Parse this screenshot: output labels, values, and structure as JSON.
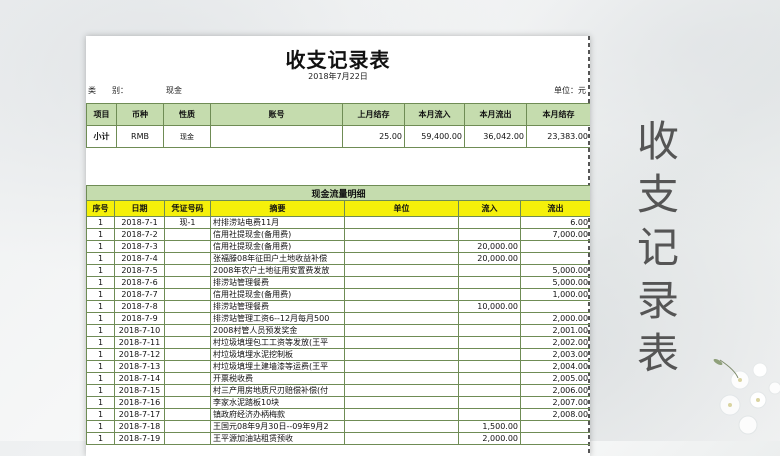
{
  "title": "收支记录表",
  "date": "2018年7月22日",
  "category_label": "类　　别：",
  "category_value": "现金",
  "unit": "单位：元",
  "headers": [
    "项目",
    "币种",
    "性质",
    "账号",
    "上月结存",
    "本月流入",
    "本月流出",
    "本月结存"
  ],
  "summary": [
    "小计",
    "RMB",
    "现金",
    "",
    "25.00",
    "59,400.00",
    "36,042.00",
    "23,383.00"
  ],
  "section_title": "现金流量明细",
  "detail_headers": [
    "序号",
    "日期",
    "凭证号码",
    "摘要",
    "单位",
    "流入",
    "流出"
  ],
  "rows": [
    [
      "1",
      "2018-7-1",
      "现-1",
      "村排涝站电费11月",
      "",
      "",
      "6.00"
    ],
    [
      "1",
      "2018-7-2",
      "",
      "信用社提现金(备用费)",
      "",
      "",
      "7,000.00"
    ],
    [
      "1",
      "2018-7-3",
      "",
      "信用社提现金(备用费)",
      "",
      "20,000.00",
      ""
    ],
    [
      "1",
      "2018-7-4",
      "",
      "张福滕08年征田户土地收益补偿",
      "",
      "20,000.00",
      ""
    ],
    [
      "1",
      "2018-7-5",
      "",
      "2008年农户土地征用安置费发放",
      "",
      "",
      "5,000.00"
    ],
    [
      "1",
      "2018-7-6",
      "",
      "排涝站管理餐费",
      "",
      "",
      "5,000.00"
    ],
    [
      "1",
      "2018-7-7",
      "",
      "信用社提现金(备用费)",
      "",
      "",
      "1,000.00"
    ],
    [
      "1",
      "2018-7-8",
      "",
      "排涝站管理餐费",
      "",
      "10,000.00",
      ""
    ],
    [
      "1",
      "2018-7-9",
      "",
      "排涝站管理工资6--12月每月500",
      "",
      "",
      "2,000.00"
    ],
    [
      "1",
      "2018-7-10",
      "",
      "2008村管人员预发奖金",
      "",
      "",
      "2,001.00"
    ],
    [
      "1",
      "2018-7-11",
      "",
      "村垃圾填埋包工工资等发放(王平",
      "",
      "",
      "2,002.00"
    ],
    [
      "1",
      "2018-7-12",
      "",
      "村垃圾填埋水泥挖制板",
      "",
      "",
      "2,003.00"
    ],
    [
      "1",
      "2018-7-13",
      "",
      "村垃圾填埋土建墙漆等运费(王平",
      "",
      "",
      "2,004.00"
    ],
    [
      "1",
      "2018-7-14",
      "",
      "开票税收费",
      "",
      "",
      "2,005.00"
    ],
    [
      "1",
      "2018-7-15",
      "",
      "村三产用房地质尺刃赔偿补偿(付",
      "",
      "",
      "2,006.00"
    ],
    [
      "1",
      "2018-7-16",
      "",
      "李家水泥踏板10块",
      "",
      "",
      "2,007.00"
    ],
    [
      "1",
      "2018-7-17",
      "",
      "镇政府经济办柄梅款",
      "",
      "",
      "2,008.00"
    ],
    [
      "1",
      "2018-7-18",
      "",
      "王国元08年9月30日--09年9月2",
      "",
      "1,500.00",
      ""
    ],
    [
      "1",
      "2018-7-19",
      "",
      "王平源加油站租赁预收",
      "",
      "2,000.00",
      ""
    ]
  ],
  "side_title": [
    "收",
    "支",
    "记",
    "录",
    "表"
  ]
}
